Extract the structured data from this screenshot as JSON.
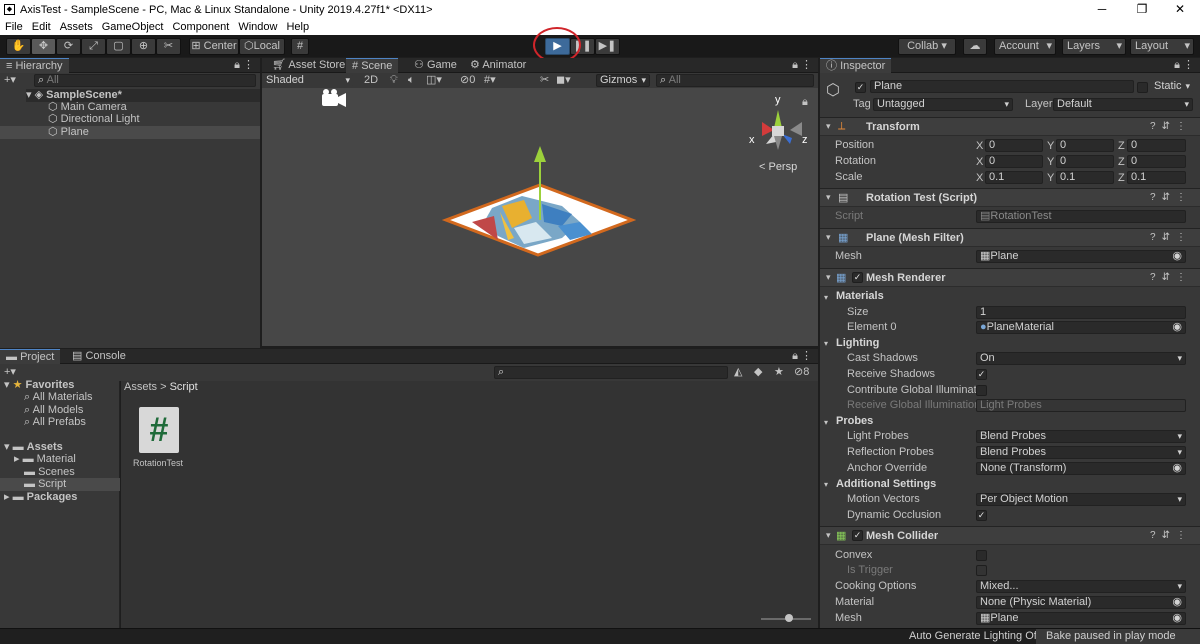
{
  "window": {
    "title": "AxisTest - SampleScene - PC, Mac & Linux Standalone - Unity 2019.4.27f1* <DX11>",
    "minimize": "─",
    "maximize": "❐",
    "close": "✕"
  },
  "menu": [
    "File",
    "Edit",
    "Assets",
    "GameObject",
    "Component",
    "Window",
    "Help"
  ],
  "toolbar": {
    "center": "Center",
    "local": "Local",
    "collab": "Collab ▾",
    "account": "Account",
    "layers": "Layers",
    "layout": "Layout"
  },
  "hierarchy": {
    "tab": "Hierarchy",
    "search": "All",
    "scene": "SampleScene*",
    "items": [
      "Main Camera",
      "Directional Light",
      "Plane"
    ]
  },
  "scene_tabs": {
    "asset_store": "Asset Store",
    "scene": "Scene",
    "game": "Game",
    "animator": "Animator"
  },
  "scene_bar": {
    "shading": "Shaded",
    "mode2d": "2D",
    "fx_count": "0",
    "gizmos": "Gizmos",
    "search": "All"
  },
  "gizmo": {
    "y": "y",
    "x": "x",
    "z": "z",
    "persp": "< Persp"
  },
  "project": {
    "tab_project": "Project",
    "tab_console": "Console",
    "breadcrumb_root": "Assets",
    "breadcrumb_sep": ">",
    "breadcrumb_leaf": "Script",
    "hidden_count": "8",
    "favorites": "Favorites",
    "fav_items": [
      "All Materials",
      "All Models",
      "All Prefabs"
    ],
    "assets": "Assets",
    "asset_folders": [
      "Material",
      "Scenes",
      "Script"
    ],
    "packages": "Packages",
    "file_name": "RotationTest",
    "file_glyph": "#"
  },
  "inspector": {
    "tab": "Inspector",
    "object_name": "Plane",
    "static": "Static",
    "tag_label": "Tag",
    "tag_value": "Untagged",
    "layer_label": "Layer",
    "layer_value": "Default",
    "transform": {
      "title": "Transform",
      "position": "Position",
      "rotation": "Rotation",
      "scale": "Scale",
      "pos": [
        "0",
        "0",
        "0"
      ],
      "rot": [
        "0",
        "0",
        "0"
      ],
      "scl": [
        "0.1",
        "0.1",
        "0.1"
      ],
      "axes": [
        "X",
        "Y",
        "Z"
      ]
    },
    "script_comp": {
      "title": "Rotation Test (Script)",
      "label": "Script",
      "value": "RotationTest"
    },
    "mesh_filter": {
      "title": "Plane (Mesh Filter)",
      "label": "Mesh",
      "value": "Plane"
    },
    "mesh_renderer": {
      "title": "Mesh Renderer",
      "materials": "Materials",
      "size_label": "Size",
      "size": "1",
      "element_label": "Element 0",
      "element": "PlaneMaterial",
      "lighting": "Lighting",
      "cast_label": "Cast Shadows",
      "cast": "On",
      "receive_label": "Receive Shadows",
      "contribute_label": "Contribute Global Illuminatio",
      "receive_gi_label": "Receive Global Illumination",
      "receive_gi": "Light Probes",
      "probes": "Probes",
      "light_probes_label": "Light Probes",
      "light_probes": "Blend Probes",
      "refl_label": "Reflection Probes",
      "refl": "Blend Probes",
      "anchor_label": "Anchor Override",
      "anchor": "None (Transform)",
      "additional": "Additional Settings",
      "motion_label": "Motion Vectors",
      "motion": "Per Object Motion",
      "dynamic_label": "Dynamic Occlusion"
    },
    "mesh_collider": {
      "title": "Mesh Collider",
      "convex": "Convex",
      "trigger": "Is Trigger",
      "cooking_label": "Cooking Options",
      "cooking": "Mixed...",
      "material_label": "Material",
      "material": "None (Physic Material)",
      "mesh_label": "Mesh",
      "mesh": "Plane"
    }
  },
  "status": {
    "auto": "Auto Generate Lighting Off",
    "bake": "Bake paused in play mode"
  },
  "colors": {
    "accent": "#4f84c4",
    "play": "#3d6a9a",
    "highlight_ring": "#d0252a"
  }
}
